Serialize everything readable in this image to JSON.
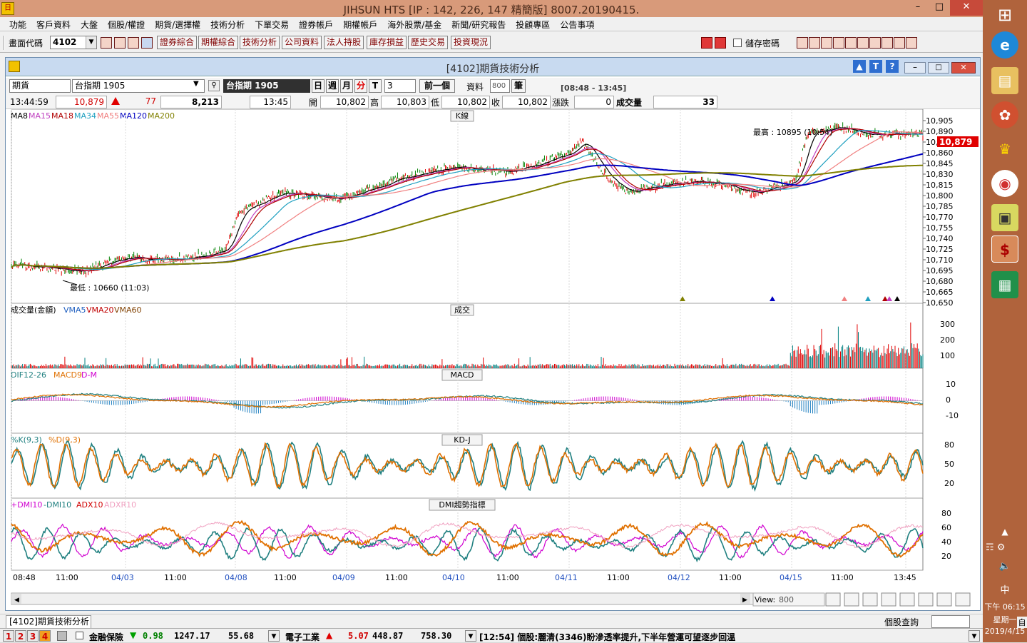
{
  "app": {
    "title": "JIHSUN HTS    [IP : 142, 226, 147 精簡版] 8007.20190415.",
    "logo": "日"
  },
  "menu": [
    "功能",
    "客戶資料",
    "大盤",
    "個股/權證",
    "期貨/選擇權",
    "技術分析",
    "下單交易",
    "證券帳戶",
    "期權帳戶",
    "海外股票/基金",
    "新聞/研究報告",
    "投顧專區",
    "公告事項"
  ],
  "toolbar": {
    "code_label": "畫面代碼",
    "code_value": "4102",
    "buttons": [
      "證券綜合",
      "期權綜合",
      "技術分析",
      "公司資料",
      "法人持股",
      "庫存損益",
      "歷史交易",
      "投資現況"
    ],
    "save_pw": "儲存密碼"
  },
  "window": {
    "title": "[4102]期貨技術分析"
  },
  "controls": {
    "market": "期貨",
    "contract": "台指期 1905",
    "contract_name": "台指期 1905",
    "day": "日",
    "week": "週",
    "month": "月",
    "minute": "分",
    "tick": "T",
    "interval": "3",
    "prev": "前一個",
    "data_label": "資料",
    "data_count": "800",
    "unit": "筆",
    "session": "[08:48 - 13:45]"
  },
  "quote": {
    "time": "13:44:59",
    "price": "10,879",
    "change": "77",
    "volume": "8,213",
    "bar_time": "13:45",
    "open_l": "開",
    "open": "10,802",
    "high_l": "高",
    "high": "10,803",
    "low_l": "低",
    "low": "10,802",
    "close_l": "收",
    "close": "10,802",
    "chg_l": "漲跌",
    "chg": "0",
    "vol_l": "成交量",
    "vol": "33"
  },
  "panels": {
    "k": {
      "title": "K線",
      "legend": [
        {
          "t": "MA8",
          "c": "#000000"
        },
        {
          "t": "MA15",
          "c": "#c040c0"
        },
        {
          "t": "MA18",
          "c": "#b00000"
        },
        {
          "t": "MA34",
          "c": "#20a0c0"
        },
        {
          "t": "MA55",
          "c": "#f08080"
        },
        {
          "t": "MA120",
          "c": "#0000c0"
        },
        {
          "t": "MA200",
          "c": "#808000"
        }
      ],
      "hi": "最高 : 10895 (10:54)",
      "lo": "最低 : 10660 (11:03)",
      "price_tag": "10,879",
      "ticks": [
        "10,905",
        "10,890",
        "10,875",
        "10,860",
        "10,845",
        "10,830",
        "10,815",
        "10,800",
        "10,785",
        "10,770",
        "10,755",
        "10,740",
        "10,725",
        "10,710",
        "10,695",
        "10,680",
        "10,665",
        "10,650"
      ]
    },
    "vol": {
      "title": "成交",
      "legend": [
        {
          "t": "成交量(金額)",
          "c": "#000000"
        },
        {
          "t": "VMA5",
          "c": "#2060c0"
        },
        {
          "t": "VMA20",
          "c": "#c00000"
        },
        {
          "t": "VMA60",
          "c": "#804000"
        }
      ],
      "ticks": [
        "300",
        "200",
        "100"
      ]
    },
    "macd": {
      "title": "MACD",
      "legend": [
        {
          "t": "DIF12-26",
          "c": "#208080"
        },
        {
          "t": "MACD9",
          "c": "#e07000"
        },
        {
          "t": "D-M",
          "c": "#d000d0"
        }
      ],
      "ticks": [
        "10",
        "0",
        "-10"
      ]
    },
    "kd": {
      "title": "KD-J",
      "legend": [
        {
          "t": "%K(9,3)",
          "c": "#208080"
        },
        {
          "t": "%D(9,3)",
          "c": "#e07000"
        }
      ],
      "ticks": [
        "80",
        "50",
        "20"
      ]
    },
    "dmi": {
      "title": "DMI趨勢指標",
      "legend": [
        {
          "t": "+DMI10",
          "c": "#d000d0"
        },
        {
          "t": "-DMI10",
          "c": "#208080"
        },
        {
          "t": "ADX10",
          "c": "#d00000"
        },
        {
          "t": "ADXR10",
          "c": "#f0a0c0"
        }
      ],
      "ticks": [
        "80",
        "60",
        "40",
        "20"
      ]
    }
  },
  "xaxis": [
    "08:48",
    "11:00",
    "04/03",
    "11:00",
    "04/08",
    "11:00",
    "04/09",
    "11:00",
    "04/10",
    "11:00",
    "04/11",
    "11:00",
    "04/12",
    "11:00",
    "04/15",
    "11:00",
    "13:45"
  ],
  "view": {
    "label": "View:",
    "value": "800"
  },
  "tab": {
    "label": "[4102]期貨技術分析",
    "stock_query": "個股查詢"
  },
  "status": {
    "pages": [
      "1",
      "2",
      "3",
      "4"
    ],
    "idx1_name": "金融保險",
    "idx1_chg": "0.98",
    "idx1_val": "1247.17",
    "idx1_vol": "55.68",
    "idx2_name": "電子工業",
    "idx2_chg": "5.07",
    "idx2_val": "448.87",
    "idx2_vol": "758.30",
    "news": "[12:54] 個股:麗清(3346)盼滲透率提升,下半年營運可望逐步回溫"
  },
  "tray": {
    "ime": "中",
    "time": "下午 06:15",
    "weekday": "星期一",
    "date": "2019/4/15",
    "ime2": "自"
  }
}
